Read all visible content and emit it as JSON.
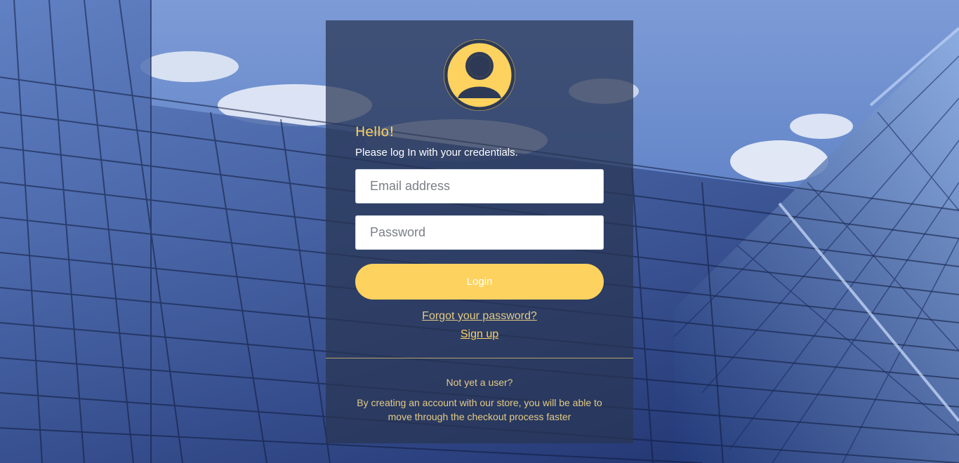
{
  "login": {
    "greeting": "Hello!",
    "subtitle": "Please log In with your credentials.",
    "email_placeholder": "Email address",
    "password_placeholder": "Password",
    "login_label": "Login",
    "forgot_label": "Forgot your password?",
    "signup_label": "Sign up",
    "not_user": "Not yet a user?",
    "info": "By creating an account with our store, you will be able to move through the checkout process faster"
  },
  "icons": {
    "avatar": "user-avatar-icon"
  },
  "colors": {
    "accent": "#fdd25e",
    "card": "#283452",
    "text_muted": "#e3cb86"
  }
}
